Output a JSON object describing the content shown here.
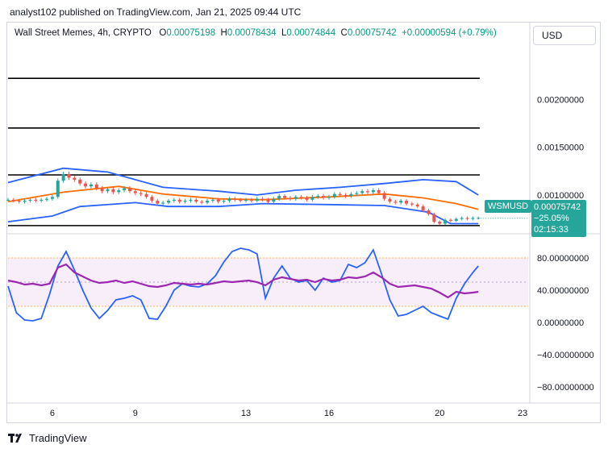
{
  "publisher_line": "analyst102 published on TradingView.com, Jan 21, 2025 09:44 UTC",
  "legend": {
    "symbol": "Wall Street Memes, 4h, CRYPTO",
    "o_label": "O",
    "o_value": "0.00075198",
    "h_label": "H",
    "h_value": "0.00078434",
    "l_label": "L",
    "l_value": "0.00074844",
    "c_label": "C",
    "c_value": "0.00075742",
    "change": "+0.00000594 (+0.79%)"
  },
  "currency_button": "USD",
  "price_tag": {
    "symbol": "WSMUSD",
    "last": "0.00075742",
    "pct": "−25.05%",
    "countdown": "02:15:33"
  },
  "footer": {
    "brand": "TradingView",
    "logo_icon": "tradingview-logo-icon"
  },
  "colors": {
    "up": "#26a69a",
    "down": "#ef5350",
    "bb_band": "#2962ff",
    "bb_basis": "#ff6d00",
    "stoch_k": "#2962ff",
    "rsi": "#9c27b0",
    "level": "#000000"
  },
  "chart_data": [
    {
      "type": "candlestick",
      "title": "",
      "x_ticks": [
        "6",
        "9",
        "13",
        "16",
        "20",
        "23"
      ],
      "x_tick_pos": [
        6,
        9,
        13,
        16,
        20,
        23
      ],
      "xlim": [
        4.4,
        23.2
      ],
      "y_ticks": [
        "0.00200000",
        "0.00150000",
        "0.00100000"
      ],
      "y_tick_values": [
        0.002,
        0.0015,
        0.001
      ],
      "ylim": [
        0.00062,
        0.00255
      ],
      "horizontal_levels": [
        0.00222,
        0.0017,
        0.00121,
        0.00068
      ],
      "candles_approx": {
        "note_values": "close prices per 4h bar, approximate",
        "x": [
          4.4,
          4.6,
          4.8,
          5.0,
          5.2,
          5.4,
          5.6,
          5.8,
          6.0,
          6.2,
          6.4,
          6.6,
          6.8,
          7.0,
          7.2,
          7.4,
          7.6,
          7.8,
          8.0,
          8.2,
          8.4,
          8.6,
          8.8,
          9.0,
          9.2,
          9.4,
          9.6,
          9.8,
          10.0,
          10.2,
          10.4,
          10.6,
          10.8,
          11.0,
          11.2,
          11.4,
          11.6,
          11.8,
          12.0,
          12.2,
          12.4,
          12.6,
          12.8,
          13.0,
          13.2,
          13.4,
          13.6,
          13.8,
          14.0,
          14.2,
          14.4,
          14.6,
          14.8,
          15.0,
          15.2,
          15.4,
          15.6,
          15.8,
          16.0,
          16.2,
          16.4,
          16.6,
          16.8,
          17.0,
          17.2,
          17.4,
          17.6,
          17.8,
          18.0,
          18.2,
          18.4,
          18.6,
          18.8,
          19.0,
          19.2,
          19.4,
          19.6,
          19.8,
          20.0,
          20.2,
          20.4,
          20.6,
          20.8,
          21.0,
          21.2,
          21.4
        ],
        "close": [
          0.00095,
          0.00094,
          0.00093,
          0.00094,
          0.00095,
          0.00094,
          0.00095,
          0.00096,
          0.00098,
          0.00115,
          0.00122,
          0.00118,
          0.00116,
          0.00112,
          0.00109,
          0.00111,
          0.00107,
          0.00104,
          0.00106,
          0.00103,
          0.00105,
          0.00107,
          0.00104,
          0.00102,
          0.00101,
          0.00098,
          0.00094,
          0.00091,
          0.00092,
          0.00094,
          0.00095,
          0.00093,
          0.00094,
          0.00095,
          0.00093,
          0.00092,
          0.00094,
          0.00095,
          0.00093,
          0.00094,
          0.00096,
          0.00095,
          0.00094,
          0.00095,
          0.00094,
          0.00096,
          0.00095,
          0.00093,
          0.00096,
          0.00099,
          0.00097,
          0.00096,
          0.00098,
          0.00097,
          0.00095,
          0.00098,
          0.00099,
          0.00097,
          0.00098,
          0.00101,
          0.001,
          0.00099,
          0.00101,
          0.00102,
          0.00104,
          0.00103,
          0.00105,
          0.00102,
          0.00096,
          0.00093,
          0.00092,
          0.00094,
          0.00091,
          0.0009,
          0.00088,
          0.00084,
          0.0008,
          0.00072,
          0.0007,
          0.00074,
          0.00073,
          0.00075,
          0.00076,
          0.00075,
          0.00076,
          0.00076
        ]
      },
      "bollinger_upper": [
        [
          4.4,
          0.00113
        ],
        [
          6.4,
          0.00128
        ],
        [
          8.0,
          0.00124
        ],
        [
          10.0,
          0.00108
        ],
        [
          12.0,
          0.00104
        ],
        [
          13.4,
          0.001
        ],
        [
          14.8,
          0.00105
        ],
        [
          16.4,
          0.00108
        ],
        [
          18.0,
          0.00112
        ],
        [
          19.4,
          0.00116
        ],
        [
          20.6,
          0.00114
        ],
        [
          21.4,
          0.001
        ]
      ],
      "bollinger_basis": [
        [
          4.4,
          0.00093
        ],
        [
          6.4,
          0.00103
        ],
        [
          8.4,
          0.00109
        ],
        [
          10.0,
          0.00101
        ],
        [
          12.0,
          0.00096
        ],
        [
          13.6,
          0.00095
        ],
        [
          16.0,
          0.00098
        ],
        [
          18.0,
          0.00101
        ],
        [
          19.4,
          0.00097
        ],
        [
          20.6,
          0.00091
        ],
        [
          21.4,
          0.00085
        ]
      ],
      "bollinger_lower": [
        [
          4.4,
          0.00072
        ],
        [
          6.0,
          0.00078
        ],
        [
          7.0,
          0.00088
        ],
        [
          9.0,
          0.00092
        ],
        [
          10.2,
          0.00088
        ],
        [
          12.0,
          0.00088
        ],
        [
          13.6,
          0.00091
        ],
        [
          16.0,
          0.0009
        ],
        [
          18.0,
          0.00089
        ],
        [
          19.6,
          0.00082
        ],
        [
          20.4,
          0.0007
        ],
        [
          21.4,
          0.0007
        ]
      ],
      "last_price": 0.00075742
    },
    {
      "type": "line",
      "title": "",
      "y_ticks": [
        "80.00000000",
        "40.00000000",
        "0.00000000",
        "−40.00000000",
        "−80.00000000"
      ],
      "y_tick_values": [
        80,
        40,
        0,
        -40,
        -80
      ],
      "ylim": [
        -100,
        100
      ],
      "bands": {
        "overbought": 80,
        "oversold": 20,
        "middle": 50
      },
      "series": [
        {
          "x": [
            4.4,
            4.7,
            5.0,
            5.3,
            5.6,
            5.9,
            6.2,
            6.5,
            6.8,
            7.1,
            7.4,
            7.7,
            8.0,
            8.3,
            8.6,
            8.9,
            9.2,
            9.5,
            9.8,
            10.1,
            10.4,
            10.7,
            11.0,
            11.3,
            11.6,
            11.9,
            12.2,
            12.5,
            12.8,
            13.1,
            13.4,
            13.7,
            14.0,
            14.3,
            14.6,
            14.9,
            15.2,
            15.5,
            15.8,
            16.1,
            16.4,
            16.7,
            17.0,
            17.3,
            17.6,
            17.9,
            18.2,
            18.5,
            18.8,
            19.1,
            19.4,
            19.7,
            20.0,
            20.3,
            20.6,
            20.9,
            21.2,
            21.4
          ],
          "y": [
            45,
            12,
            3,
            2,
            5,
            35,
            70,
            88,
            65,
            40,
            18,
            5,
            15,
            28,
            30,
            33,
            28,
            5,
            4,
            20,
            40,
            48,
            45,
            44,
            48,
            58,
            75,
            88,
            92,
            90,
            85,
            30,
            55,
            70,
            55,
            50,
            52,
            40,
            55,
            50,
            52,
            72,
            68,
            74,
            90,
            60,
            28,
            8,
            10,
            15,
            20,
            12,
            8,
            4,
            30,
            48,
            62,
            70
          ]
        },
        {
          "x": [
            4.4,
            4.7,
            5.0,
            5.3,
            5.6,
            5.9,
            6.2,
            6.5,
            6.8,
            7.1,
            7.4,
            7.7,
            8.0,
            8.3,
            8.6,
            8.9,
            9.2,
            9.5,
            9.8,
            10.1,
            10.4,
            10.7,
            11.0,
            11.3,
            11.6,
            11.9,
            12.2,
            12.5,
            12.8,
            13.1,
            13.4,
            13.7,
            14.0,
            14.3,
            14.6,
            14.9,
            15.2,
            15.5,
            15.8,
            16.1,
            16.4,
            16.7,
            17.0,
            17.3,
            17.6,
            17.9,
            18.2,
            18.5,
            18.8,
            19.1,
            19.4,
            19.7,
            20.0,
            20.3,
            20.6,
            20.9,
            21.2,
            21.4
          ],
          "y": [
            52,
            50,
            47,
            48,
            46,
            48,
            68,
            72,
            62,
            57,
            52,
            49,
            50,
            52,
            49,
            51,
            48,
            45,
            44,
            46,
            49,
            48,
            47,
            48,
            47,
            49,
            51,
            50,
            51,
            52,
            50,
            46,
            53,
            56,
            54,
            52,
            53,
            50,
            54,
            52,
            53,
            56,
            55,
            57,
            62,
            56,
            48,
            44,
            45,
            46,
            44,
            42,
            37,
            31,
            38,
            36,
            37,
            38
          ]
        }
      ]
    }
  ]
}
